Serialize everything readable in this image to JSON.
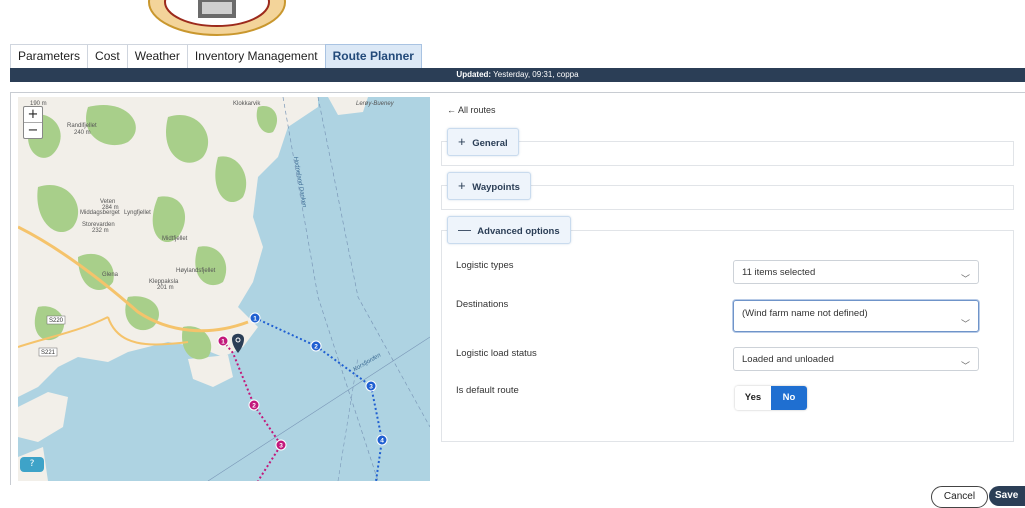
{
  "tabs": [
    {
      "label": "Parameters"
    },
    {
      "label": "Cost"
    },
    {
      "label": "Weather"
    },
    {
      "label": "Inventory Management"
    },
    {
      "label": "Route Planner",
      "active": true
    }
  ],
  "status": {
    "label": "Updated:",
    "value": "Yesterday, 09:31, coppa"
  },
  "map": {
    "zoom_in": "+",
    "zoom_out": "−",
    "labels": [
      "190 m",
      "Klokkarvik",
      "Lerøy-Bueney",
      "Randifjellet",
      "240 m",
      "Veten",
      "284 m",
      "Middagsberget",
      "Lyngfjellet",
      "Storevarden",
      "232 m",
      "Midtfjellet",
      "Høylandsfjellet",
      "Kleppaksla",
      "201 m",
      "Glena",
      "S220",
      "S221",
      "Hodneland Danken",
      "Korsfjorden"
    ],
    "route_blue": [
      "1",
      "2",
      "3",
      "4"
    ],
    "route_pink": [
      "1",
      "2",
      "3"
    ],
    "help": "?",
    "colors": {
      "water": "#aed3e2",
      "land": "#f2efe9",
      "forest": "#a8cf8a",
      "route_blue": "#1f5fd1",
      "route_pink": "#c2187b",
      "road": "#f5c36b"
    }
  },
  "panel": {
    "back": "All routes",
    "back_icon": "arrow-left-icon",
    "general": "General",
    "waypoints": "Waypoints",
    "advanced": "Advanced options",
    "plus": "+",
    "minus": "—"
  },
  "fields": {
    "logistic_types": {
      "label": "Logistic types",
      "value": "11 items selected"
    },
    "destinations": {
      "label": "Destinations",
      "value": "(Wind farm name not defined)"
    },
    "load_status": {
      "label": "Logistic load status",
      "value": "Loaded and unloaded"
    },
    "default_route": {
      "label": "Is default route",
      "yes": "Yes",
      "no": "No",
      "selected": "No"
    }
  },
  "actions": {
    "cancel": "Cancel",
    "save": "Save"
  }
}
